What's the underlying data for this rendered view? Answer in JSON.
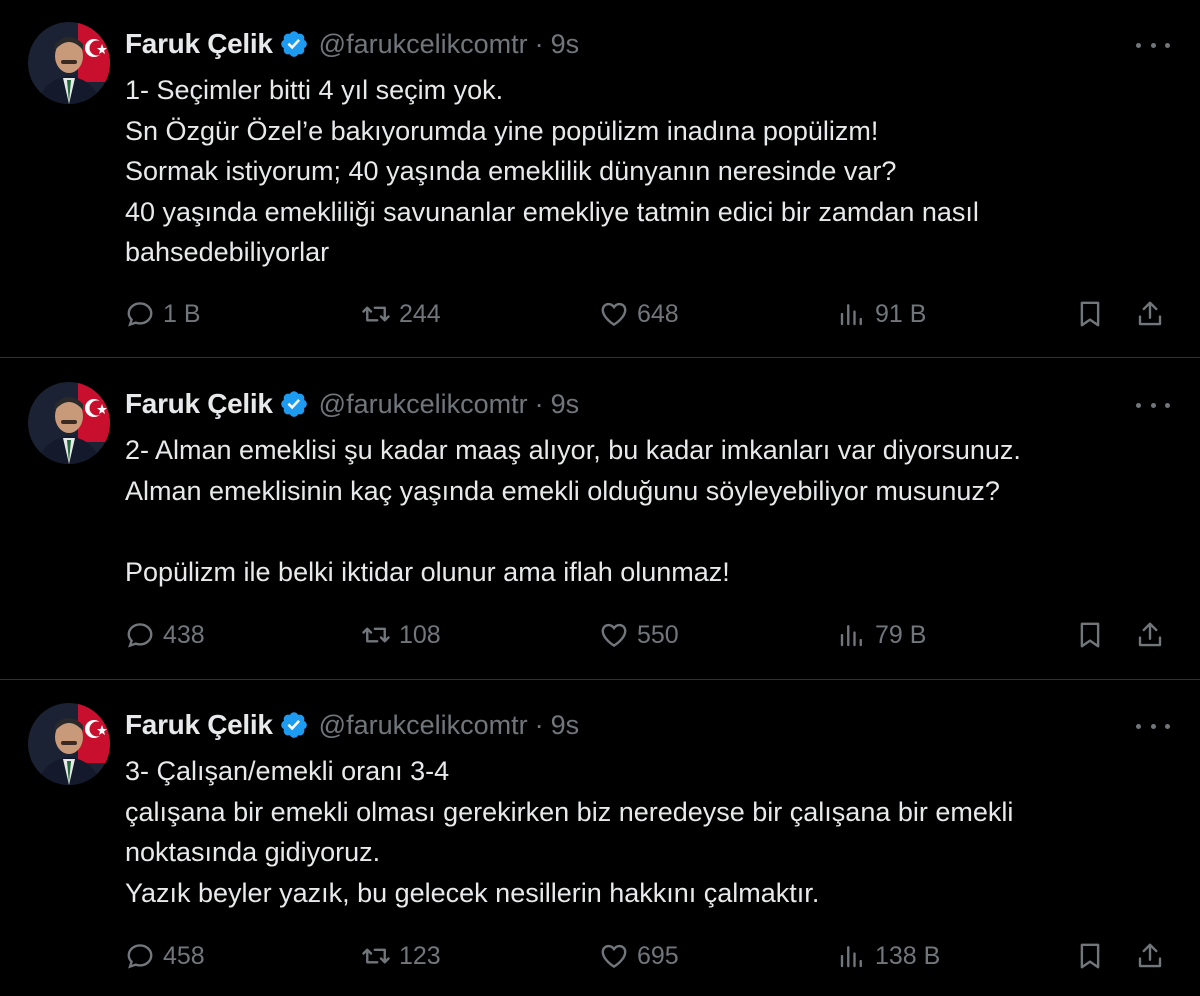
{
  "colors": {
    "background": "#000000",
    "text": "#e7e9ea",
    "secondary": "#71767b",
    "verified": "#1d9bf0",
    "divider": "#2f3336"
  },
  "tweets": [
    {
      "author": {
        "name": "Faruk Çelik",
        "handle": "@farukcelikcomtr",
        "time": "9s"
      },
      "lines": [
        "1- Seçimler bitti 4 yıl seçim yok.",
        "Sn Özgür Özel’e bakıyorumda yine popülizm inadına popülizm!",
        "Sormak istiyorum; 40 yaşında emeklilik dünyanın neresinde var?",
        "40 yaşında emekliliği savunanlar emekliye tatmin edici bir zamdan nasıl",
        "bahsedebiliyorlar"
      ],
      "stats": {
        "replies": "1 B",
        "retweets": "244",
        "likes": "648",
        "views": "91 B"
      }
    },
    {
      "author": {
        "name": "Faruk Çelik",
        "handle": "@farukcelikcomtr",
        "time": "9s"
      },
      "lines": [
        "2- Alman emeklisi şu kadar maaş alıyor, bu kadar imkanları var diyorsunuz.",
        "Alman emeklisinin kaç yaşında emekli olduğunu söyleyebiliyor musunuz?",
        "",
        "Popülizm ile belki iktidar olunur ama iflah olunmaz!"
      ],
      "stats": {
        "replies": "438",
        "retweets": "108",
        "likes": "550",
        "views": "79 B"
      }
    },
    {
      "author": {
        "name": "Faruk Çelik",
        "handle": "@farukcelikcomtr",
        "time": "9s"
      },
      "lines": [
        "3- Çalışan/emekli oranı 3-4",
        "çalışana bir emekli olması gerekirken biz neredeyse bir çalışana bir emekli",
        "noktasında gidiyoruz.",
        "Yazık beyler yazık,  bu gelecek nesillerin hakkını çalmaktır."
      ],
      "stats": {
        "replies": "458",
        "retweets": "123",
        "likes": "695",
        "views": "138 B"
      }
    }
  ],
  "icons": {
    "header": [
      "verified-badge-icon",
      "more-icon"
    ],
    "actions": [
      "reply-icon",
      "retweet-icon",
      "like-icon",
      "views-icon",
      "bookmark-icon",
      "share-icon"
    ]
  }
}
